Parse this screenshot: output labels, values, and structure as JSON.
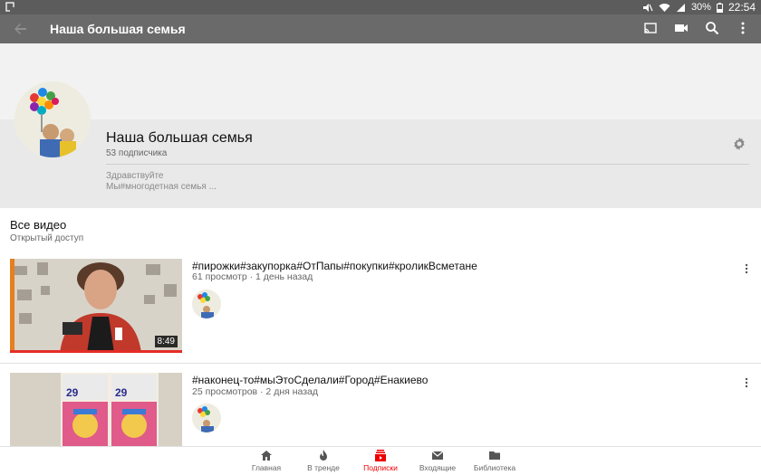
{
  "status": {
    "battery": "30%",
    "time": "22:54"
  },
  "appbar": {
    "title": "Наша большая семья"
  },
  "channel": {
    "name": "Наша большая семья",
    "subscribers": "53 подписчика",
    "description_line1": "Здравствуйте",
    "description_line2": "Мы#многодетная семья ..."
  },
  "section": {
    "title": "Все видео",
    "subtitle": "Открытый доступ"
  },
  "videos": [
    {
      "title": "#пирожки#закупорка#ОтПапы#покупки#кроликВсметане",
      "meta": "61 просмотр · 1 день назад",
      "duration": "8:49",
      "watched_fraction": 1.0
    },
    {
      "title": "#наконец-то#мыЭтоСделали#Город#Енакиево",
      "meta": "25 просмотров · 2 дня назад"
    }
  ],
  "nav": {
    "items": [
      {
        "label": "Главная",
        "icon": "home-icon"
      },
      {
        "label": "В тренде",
        "icon": "flame-icon"
      },
      {
        "label": "Подписки",
        "icon": "subscriptions-icon"
      },
      {
        "label": "Входящие",
        "icon": "mail-icon"
      },
      {
        "label": "Библиотека",
        "icon": "folder-icon"
      }
    ],
    "active_index": 2
  },
  "colors": {
    "accent": "#e00000",
    "appbar": "#6a6a6a",
    "statusbar": "#5c5c5c"
  }
}
